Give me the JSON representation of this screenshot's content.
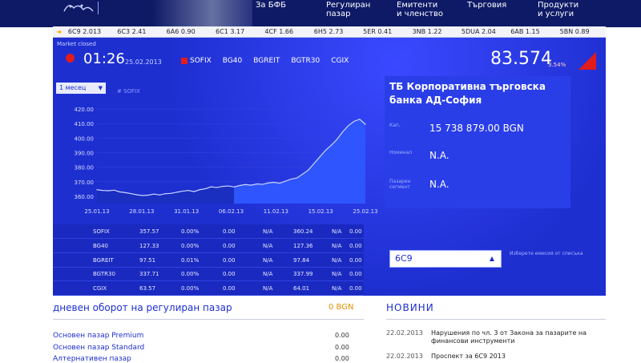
{
  "header": {
    "logo_subtext": "",
    "nav": [
      {
        "label": "За БФБ"
      },
      {
        "label": "Регулиран\nпазар"
      },
      {
        "label": "Емитенти\nи членство"
      },
      {
        "label": "Търговия"
      },
      {
        "label": "Продукти\nи услуги"
      }
    ]
  },
  "ticker": {
    "items": [
      "◄",
      "6C9 2.013",
      "6C3 2.41",
      "6A6 0.90",
      "6C1 3.17",
      "4CF 1.66",
      "6H5 2.73",
      "5ER 0.41",
      "3NB 1.22",
      "5DUA 2.04",
      "6AB 1.15",
      "5BN 0.89"
    ]
  },
  "market": {
    "status": "Market closed",
    "time": "01:26",
    "date": "25.02.2013",
    "tabs": [
      "SOFIX",
      "BG40",
      "BGREIT",
      "BGTR30",
      "CGIX"
    ],
    "value": "83.574",
    "change": "3.54%",
    "accent": "#e21b1b"
  },
  "chart_controls": {
    "period": "1 месец",
    "series_label": "# SOFIX"
  },
  "chart_data": {
    "type": "area",
    "x_ticks": [
      "25.01.13",
      "28.01.13",
      "31.01.13",
      "06.02.13",
      "11.02.13",
      "15.02.13",
      "25.02.13"
    ],
    "y_ticks": [
      "420.00",
      "410.00",
      "400.00",
      "390.00",
      "380.00",
      "370.00",
      "360.00"
    ],
    "ylim": [
      355,
      425
    ],
    "values": [
      364.5,
      364.0,
      363.8,
      364.2,
      363.0,
      362.5,
      361.8,
      361.0,
      360.5,
      360.8,
      361.5,
      360.9,
      361.8,
      362.0,
      362.8,
      363.5,
      364.0,
      363.2,
      364.5,
      365.2,
      366.5,
      366.0,
      366.8,
      367.1,
      366.4,
      367.4,
      368.1,
      367.6,
      368.5,
      368.2,
      369.2,
      369.6,
      369.0,
      370.4,
      371.8,
      372.6,
      375.2,
      378.0,
      382.5,
      387.0,
      391.5,
      395.0,
      399.0,
      404.2,
      408.5,
      411.5,
      413.0,
      409.5
    ],
    "highlight_start_index": 24,
    "colors": {
      "line": "#c8d6ff",
      "fill_old": "#1a2ec0",
      "fill_new": "#2f55ff"
    }
  },
  "company": {
    "name": "ТБ Корпоративна търговска банка АД-София",
    "rows": [
      {
        "label": "Кап.",
        "value": "15 738 879.00  BGN"
      },
      {
        "label": "Номинал",
        "value": "N.A."
      },
      {
        "label": "Пазарен сегмент",
        "value": "N.A."
      }
    ]
  },
  "stats": {
    "rows": [
      [
        "SOFIX",
        "357.57",
        "0.00%",
        "0.00",
        "N/A",
        "360.24",
        "N/A",
        "0.00"
      ],
      [
        "BG40",
        "127.33",
        "0.00%",
        "0.00",
        "N/A",
        "127.36",
        "N/A",
        "0.00"
      ],
      [
        "BGREIT",
        "97.51",
        "0.01%",
        "0.00",
        "N/A",
        "97.84",
        "N/A",
        "0.00"
      ],
      [
        "BGTR30",
        "337.71",
        "0.00%",
        "0.00",
        "N/A",
        "337.99",
        "N/A",
        "0.00"
      ],
      [
        "CGIX",
        "63.57",
        "0.00%",
        "0.00",
        "N/A",
        "64.01",
        "N/A",
        "0.00"
      ]
    ]
  },
  "search": {
    "value": "6C9",
    "hint": "Изберете емисия от списъка"
  },
  "turnover": {
    "heading": "дневен оборот на регулиран пазар",
    "value": "0 BGN",
    "items": [
      {
        "label": "Основен пазар Premium",
        "value": "0.00"
      },
      {
        "label": "Основен пазар Standard",
        "value": "0.00"
      },
      {
        "label": "Алтернативен пазар",
        "value": "0.00"
      }
    ]
  },
  "news": {
    "heading": "НОВИНИ",
    "items": [
      {
        "date": "22.02.2013",
        "title": "Нарушения по чл. 3 от Закона за пазарите на финансови инструменти"
      },
      {
        "date": "22.02.2013",
        "title": "Проспект за 6C9 2013"
      }
    ]
  }
}
